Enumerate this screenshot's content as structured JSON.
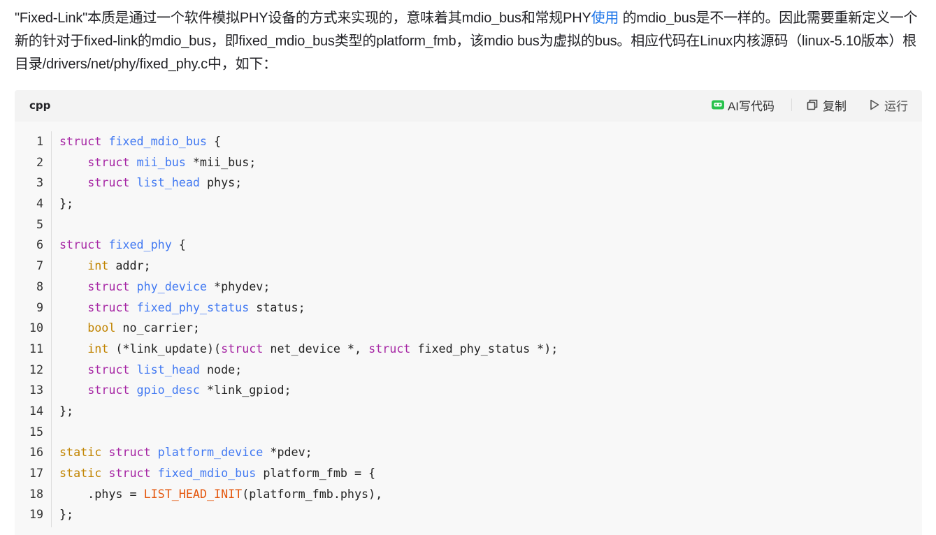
{
  "article": {
    "intro_before_link": "\"Fixed-Link\"本质是通过一个软件模拟PHY设备的方式来实现的，意味着其mdio_bus和常规PHY",
    "intro_link": "使用",
    "intro_after_link": " 的mdio_bus是不一样的。因此需要重新定义一个新的针对于fixed-link的mdio_bus，即fixed_mdio_bus类型的platform_fmb，该mdio bus为虚拟的bus。相应代码在Linux内核源码（linux-5.10版本）根目录/drivers/net/phy/fixed_phy.c中，如下："
  },
  "code_block": {
    "language": "cpp",
    "toolbar": {
      "ai_label": "AI写代码",
      "copy_label": "复制",
      "run_label": "运行"
    },
    "lines": [
      {
        "n": "1",
        "tokens": [
          {
            "t": "struct",
            "c": "kw"
          },
          {
            "t": " "
          },
          {
            "t": "fixed_mdio_bus",
            "c": "ty"
          },
          {
            "t": " {"
          }
        ]
      },
      {
        "n": "2",
        "tokens": [
          {
            "t": "    "
          },
          {
            "t": "struct",
            "c": "kw"
          },
          {
            "t": " "
          },
          {
            "t": "mii_bus",
            "c": "ty"
          },
          {
            "t": " *mii_bus;"
          }
        ]
      },
      {
        "n": "3",
        "tokens": [
          {
            "t": "    "
          },
          {
            "t": "struct",
            "c": "kw"
          },
          {
            "t": " "
          },
          {
            "t": "list_head",
            "c": "ty"
          },
          {
            "t": " phys;"
          }
        ]
      },
      {
        "n": "4",
        "tokens": [
          {
            "t": "};"
          }
        ]
      },
      {
        "n": "5",
        "tokens": []
      },
      {
        "n": "6",
        "tokens": [
          {
            "t": "struct",
            "c": "kw"
          },
          {
            "t": " "
          },
          {
            "t": "fixed_phy",
            "c": "ty"
          },
          {
            "t": " {"
          }
        ]
      },
      {
        "n": "7",
        "tokens": [
          {
            "t": "    "
          },
          {
            "t": "int",
            "c": "bt"
          },
          {
            "t": " addr;"
          }
        ]
      },
      {
        "n": "8",
        "tokens": [
          {
            "t": "    "
          },
          {
            "t": "struct",
            "c": "kw"
          },
          {
            "t": " "
          },
          {
            "t": "phy_device",
            "c": "ty"
          },
          {
            "t": " *phydev;"
          }
        ]
      },
      {
        "n": "9",
        "tokens": [
          {
            "t": "    "
          },
          {
            "t": "struct",
            "c": "kw"
          },
          {
            "t": " "
          },
          {
            "t": "fixed_phy_status",
            "c": "ty"
          },
          {
            "t": " status;"
          }
        ]
      },
      {
        "n": "10",
        "tokens": [
          {
            "t": "    "
          },
          {
            "t": "bool",
            "c": "bt"
          },
          {
            "t": " no_carrier;"
          }
        ]
      },
      {
        "n": "11",
        "tokens": [
          {
            "t": "    "
          },
          {
            "t": "int",
            "c": "bt"
          },
          {
            "t": " (*link_update)("
          },
          {
            "t": "struct",
            "c": "kw"
          },
          {
            "t": " net_device *, "
          },
          {
            "t": "struct",
            "c": "kw"
          },
          {
            "t": " fixed_phy_status *);"
          }
        ]
      },
      {
        "n": "12",
        "tokens": [
          {
            "t": "    "
          },
          {
            "t": "struct",
            "c": "kw"
          },
          {
            "t": " "
          },
          {
            "t": "list_head",
            "c": "ty"
          },
          {
            "t": " node;"
          }
        ]
      },
      {
        "n": "13",
        "tokens": [
          {
            "t": "    "
          },
          {
            "t": "struct",
            "c": "kw"
          },
          {
            "t": " "
          },
          {
            "t": "gpio_desc",
            "c": "ty"
          },
          {
            "t": " *link_gpiod;"
          }
        ]
      },
      {
        "n": "14",
        "tokens": [
          {
            "t": "};"
          }
        ]
      },
      {
        "n": "15",
        "tokens": []
      },
      {
        "n": "16",
        "tokens": [
          {
            "t": "static",
            "c": "bt"
          },
          {
            "t": " "
          },
          {
            "t": "struct",
            "c": "kw"
          },
          {
            "t": " "
          },
          {
            "t": "platform_device",
            "c": "ty"
          },
          {
            "t": " *pdev;"
          }
        ]
      },
      {
        "n": "17",
        "tokens": [
          {
            "t": "static",
            "c": "bt"
          },
          {
            "t": " "
          },
          {
            "t": "struct",
            "c": "kw"
          },
          {
            "t": " "
          },
          {
            "t": "fixed_mdio_bus",
            "c": "ty"
          },
          {
            "t": " platform_fmb = {"
          }
        ]
      },
      {
        "n": "18",
        "tokens": [
          {
            "t": "    .phys = "
          },
          {
            "t": "LIST_HEAD_INIT",
            "c": "mc"
          },
          {
            "t": "(platform_fmb.phys),"
          }
        ]
      },
      {
        "n": "19",
        "tokens": [
          {
            "t": "};"
          }
        ]
      }
    ]
  },
  "colors": {
    "keyword": "#a626a4",
    "type_name": "#4078f2",
    "builtin": "#c18401",
    "macro": "#e4560c",
    "link": "#1a73e8",
    "ai_icon": "#27c24c"
  },
  "icons": {
    "ai": "robot-chat-icon",
    "copy": "copy-icon",
    "run": "play-icon"
  }
}
